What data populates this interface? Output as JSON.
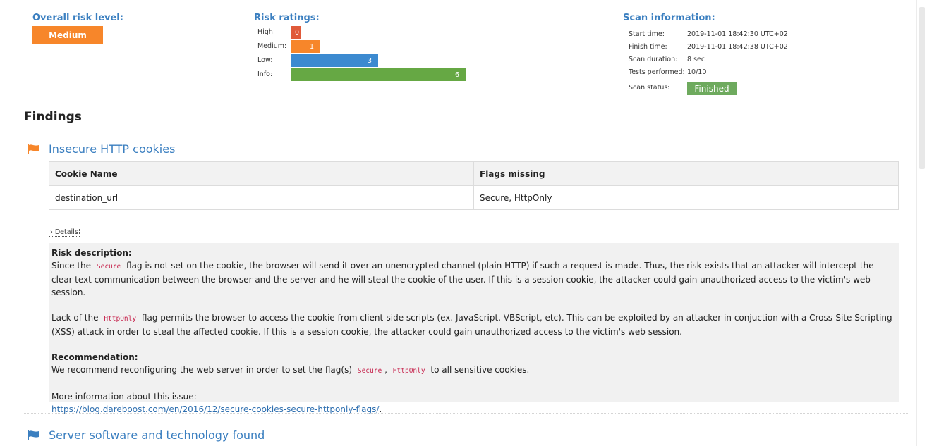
{
  "summary": {
    "overall_label": "Overall risk level:",
    "overall_value": "Medium",
    "ratings_label": "Risk ratings:",
    "ratings": [
      {
        "label": "High:",
        "count": "0",
        "color": "#e05a3a"
      },
      {
        "label": "Medium:",
        "count": "1",
        "color": "#f7862a"
      },
      {
        "label": "Low:",
        "count": "3",
        "color": "#3c8ad0"
      },
      {
        "label": "Info:",
        "count": "6",
        "color": "#66a844"
      }
    ],
    "scan_label": "Scan information:",
    "scan": {
      "start_key": "Start time:",
      "start_val": "2019-11-01 18:42:30 UTC+02",
      "finish_key": "Finish time:",
      "finish_val": "2019-11-01 18:42:38 UTC+02",
      "duration_key": "Scan duration:",
      "duration_val": "8 sec",
      "tests_key": "Tests performed:",
      "tests_val": "10/10",
      "status_key": "Scan status:",
      "status_val": "Finished"
    }
  },
  "findings": {
    "title": "Findings",
    "cookies": {
      "title": "Insecure HTTP cookies",
      "icon": "flag-icon",
      "icon_color": "#f7862a",
      "headers": [
        "Cookie Name",
        "Flags missing"
      ],
      "rows": [
        [
          "destination_url",
          "Secure, HttpOnly"
        ]
      ],
      "details_label": "Details",
      "risk_heading": "Risk description:",
      "p1a": "Since the",
      "p1_code": "Secure",
      "p1b": "flag is not set on the cookie, the browser will send it over an unencrypted channel (plain HTTP) if such a request is made. Thus, the risk exists that an attacker will intercept the clear-text communication between the browser and the server and he will steal the cookie of the user. If this is a session cookie, the attacker could gain unauthorized access to the victim's web session.",
      "p2a": "Lack of the",
      "p2_code": "HttpOnly",
      "p2b": "flag permits the browser to access the cookie from client-side scripts (ex. JavaScript, VBScript, etc). This can be exploited by an attacker in conjuction with a Cross-Site Scripting (XSS) attack in order to steal the affected cookie. If this is a session cookie, the attacker could gain unauthorized access to the victim's web session.",
      "rec_heading": "Recommendation:",
      "rec_a": "We recommend reconfiguring the web server in order to set the flag(s)",
      "rec_code1": "Secure",
      "rec_sep": ",",
      "rec_code2": "HttpOnly",
      "rec_b": "to all sensitive cookies.",
      "more_info": "More information about this issue:",
      "link": "https://blog.dareboost.com/en/2016/12/secure-cookies-secure-httponly-flags/",
      "link_suffix": "."
    },
    "server": {
      "title": "Server software and technology found",
      "icon": "flag-icon",
      "icon_color": "#3b7fc0"
    }
  }
}
